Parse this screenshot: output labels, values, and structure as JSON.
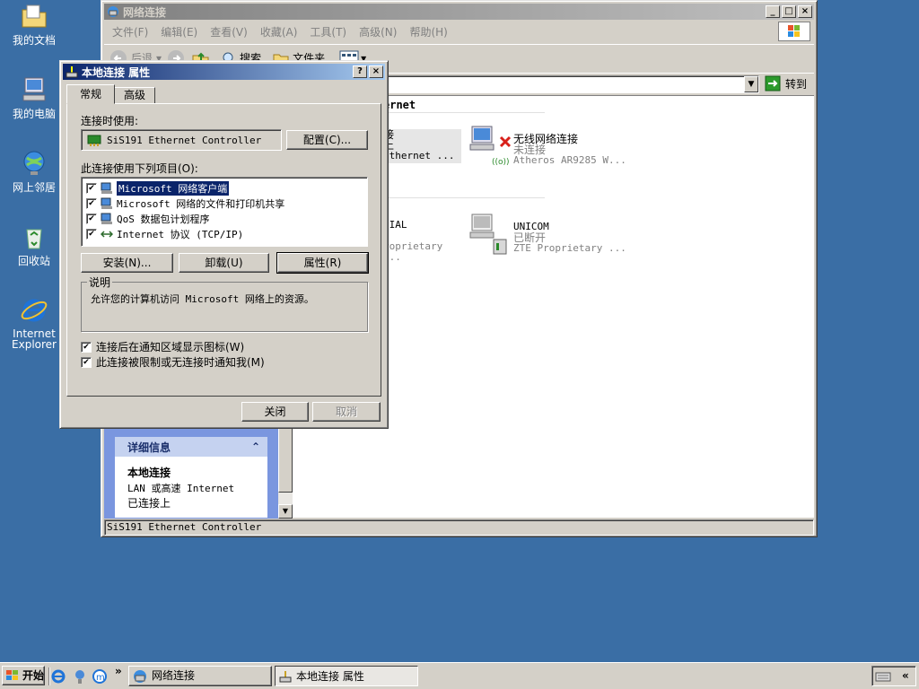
{
  "desktop": {
    "icons": [
      {
        "label": "我的文档"
      },
      {
        "label": "我的电脑"
      },
      {
        "label": "网上邻居"
      },
      {
        "label": "回收站"
      },
      {
        "label_line1": "Internet",
        "label_line2": "Explorer"
      }
    ]
  },
  "net_window": {
    "title": "网络连接",
    "menu": [
      "文件(F)",
      "编辑(E)",
      "查看(V)",
      "收藏(A)",
      "工具(T)",
      "高级(N)",
      "帮助(H)"
    ],
    "toolbar": {
      "back": "后退",
      "search": "搜索",
      "folders": "文件夹"
    },
    "address": {
      "go_label": "转到"
    },
    "group_header": "ernet",
    "connections": [
      {
        "name_partial": "接",
        "status_partial": "上",
        "device_partial": "Ethernet ..."
      },
      {
        "name": "无线网络连接",
        "status": "未连接",
        "device": "Atheros AR9285 W..."
      },
      {
        "name_partial": "DIAL",
        "device_partial": "roprietary ..."
      },
      {
        "name": "UNICOM",
        "status": "已断开",
        "device": "ZTE Proprietary ..."
      }
    ],
    "details": {
      "header": "详细信息",
      "name": "本地连接",
      "type": "LAN 或高速 Internet",
      "status": "已连接上"
    },
    "statusbar": "SiS191 Ethernet Controller"
  },
  "props_dialog": {
    "title": "本地连接 属性",
    "tabs": [
      "常规",
      "高级"
    ],
    "connect_using_label": "连接时使用:",
    "adapter": "SiS191 Ethernet Controller",
    "configure_btn": "配置(C)...",
    "items_label": "此连接使用下列项目(O):",
    "items": [
      "Microsoft 网络客户端",
      "Microsoft 网络的文件和打印机共享",
      "QoS 数据包计划程序",
      "Internet 协议 (TCP/IP)"
    ],
    "install_btn": "安装(N)...",
    "uninstall_btn": "卸载(U)",
    "properties_btn": "属性(R)",
    "description_label": "说明",
    "description_text": "允许您的计算机访问 Microsoft 网络上的资源。",
    "show_icon_label": "连接后在通知区域显示图标(W)",
    "notify_label": "此连接被限制或无连接时通知我(M)",
    "close_btn": "关闭",
    "cancel_btn": "取消"
  },
  "taskbar": {
    "start": "开始",
    "tasks": [
      "网络连接",
      "本地连接 属性"
    ]
  }
}
